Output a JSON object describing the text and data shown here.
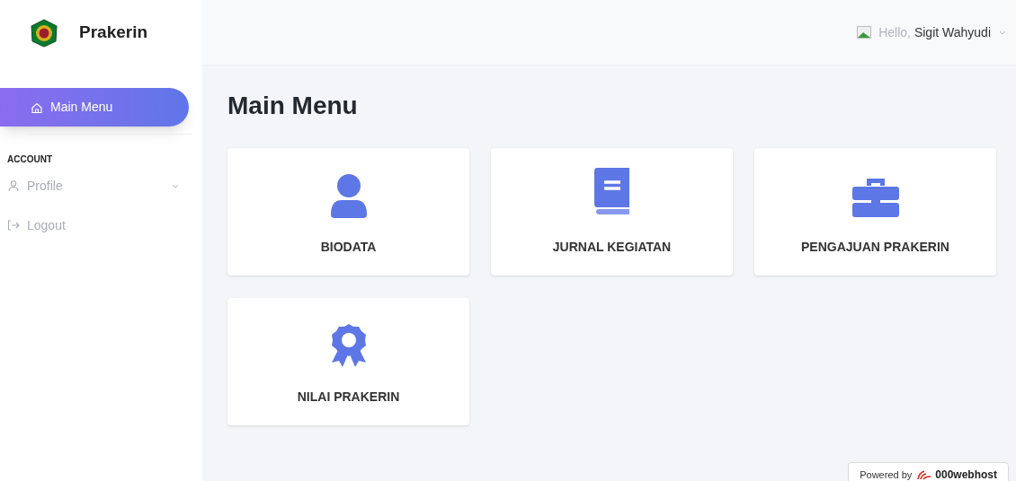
{
  "brand": {
    "title": "Prakerin"
  },
  "sidebar": {
    "items": [
      {
        "label": "Main Menu",
        "kind": "home",
        "selected": true
      }
    ],
    "section": "ACCOUNT",
    "account_items": [
      {
        "label": "Profile",
        "kind": "profile",
        "has_submenu": true
      },
      {
        "label": "Logout",
        "kind": "logout",
        "has_submenu": false
      }
    ]
  },
  "header": {
    "greeting": "Hello,",
    "user": "Sigit Wahyudi"
  },
  "page_title": "Main Menu",
  "cards": [
    {
      "label": "BIODATA",
      "kind": "user"
    },
    {
      "label": "JURNAL KEGIATAN",
      "kind": "book"
    },
    {
      "label": "PENGAJUAN PRAKERIN",
      "kind": "briefcase"
    },
    {
      "label": "NILAI PRAKERIN",
      "kind": "award"
    }
  ],
  "footer_badge": {
    "prefix": "Powered by",
    "brand": "000webhost"
  }
}
